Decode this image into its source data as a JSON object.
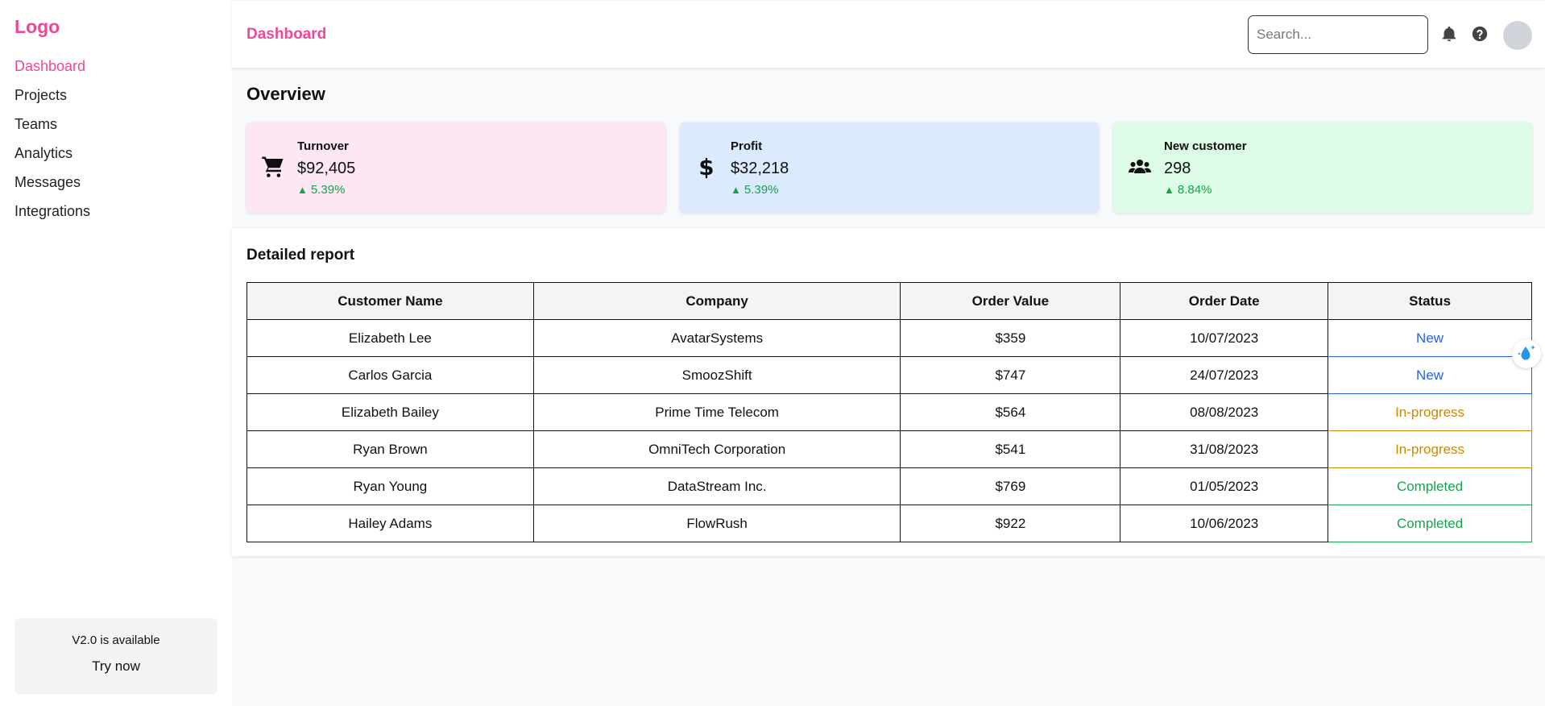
{
  "sidebar": {
    "logo": "Logo",
    "items": [
      {
        "label": "Dashboard",
        "active": true
      },
      {
        "label": "Projects"
      },
      {
        "label": "Teams"
      },
      {
        "label": "Analytics"
      },
      {
        "label": "Messages"
      },
      {
        "label": "Integrations"
      }
    ],
    "promo": {
      "text": "V2.0 is available",
      "button": "Try now"
    }
  },
  "header": {
    "title": "Dashboard",
    "search_placeholder": "Search...",
    "icons": [
      "bell-icon",
      "help-icon",
      "avatar"
    ]
  },
  "overview": {
    "title": "Overview",
    "cards": [
      {
        "icon": "cart-icon",
        "label": "Turnover",
        "value": "$92,405",
        "change": "5.39%",
        "bg": "#fce7f3"
      },
      {
        "icon": "dollar-icon",
        "label": "Profit",
        "value": "$32,218",
        "change": "5.39%",
        "bg": "#dbeafe"
      },
      {
        "icon": "users-icon",
        "label": "New customer",
        "value": "298",
        "change": "8.84%",
        "bg": "#dcfce7"
      }
    ]
  },
  "report": {
    "title": "Detailed report",
    "columns": [
      "Customer Name",
      "Company",
      "Order Value",
      "Order Date",
      "Status"
    ],
    "rows": [
      [
        "Elizabeth Lee",
        "AvatarSystems",
        "$359",
        "10/07/2023",
        "New"
      ],
      [
        "Carlos Garcia",
        "SmoozShift",
        "$747",
        "24/07/2023",
        "New"
      ],
      [
        "Elizabeth Bailey",
        "Prime Time Telecom",
        "$564",
        "08/08/2023",
        "In-progress"
      ],
      [
        "Ryan Brown",
        "OmniTech Corporation",
        "$541",
        "31/08/2023",
        "In-progress"
      ],
      [
        "Ryan Young",
        "DataStream Inc.",
        "$769",
        "01/05/2023",
        "Completed"
      ],
      [
        "Hailey Adams",
        "FlowRush",
        "$922",
        "10/06/2023",
        "Completed"
      ]
    ]
  },
  "colors": {
    "accent": "#ec4899",
    "positive": "#16a34a",
    "status_new": "#2563eb",
    "status_progress": "#ca8a04",
    "status_completed": "#16a34a"
  }
}
